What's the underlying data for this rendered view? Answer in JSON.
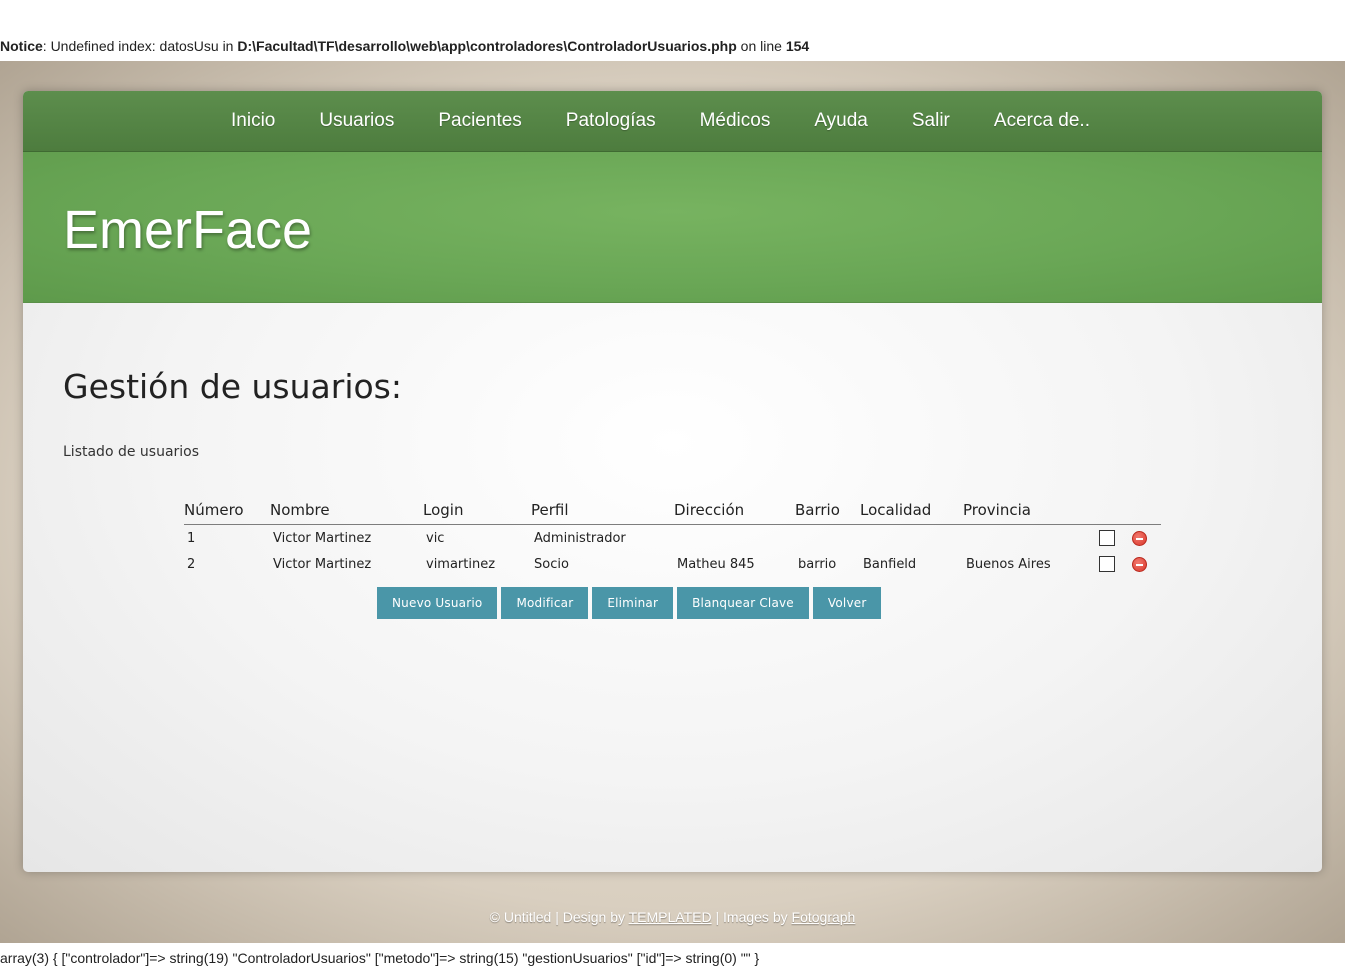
{
  "notice": {
    "label": "Notice",
    "message": ": Undefined index: datosUsu in ",
    "path": "D:\\Facultad\\TF\\desarrollo\\web\\app\\controladores\\ControladorUsuarios.php",
    "on_line": " on line ",
    "line": "154"
  },
  "nav": {
    "items": [
      "Inicio",
      "Usuarios",
      "Pacientes",
      "Patologías",
      "Médicos",
      "Ayuda",
      "Salir",
      "Acerca de.."
    ]
  },
  "site_title": "EmerFace",
  "page_heading": "Gestión de usuarios:",
  "subtitle": "Listado de usuarios",
  "table": {
    "headers": [
      "Número",
      "Nombre",
      "Login",
      "Perfil",
      "Dirección",
      "Barrio",
      "Localidad",
      "Provincia"
    ],
    "rows": [
      [
        "1",
        "Victor Martinez",
        "vic",
        "Administrador",
        "",
        "",
        "",
        ""
      ],
      [
        "2",
        "Victor Martinez",
        "vimartinez",
        "Socio",
        "Matheu 845",
        "barrio",
        "Banfield",
        "Buenos Aires"
      ]
    ]
  },
  "buttons": {
    "new_user": "Nuevo Usuario",
    "modify": "Modificar",
    "delete": "Eliminar",
    "reset_password": "Blanquear Clave",
    "back": "Volver"
  },
  "footer": {
    "copyright": "© Untitled | Design by ",
    "templated": "TEMPLATED",
    "images_by": " | Images by ",
    "fotograph": "Fotograph"
  },
  "debug": "array(3) { [\"controlador\"]=> string(19) \"ControladorUsuarios\" [\"metodo\"]=> string(15) \"gestionUsuarios\" [\"id\"]=> string(0) \"\" }"
}
